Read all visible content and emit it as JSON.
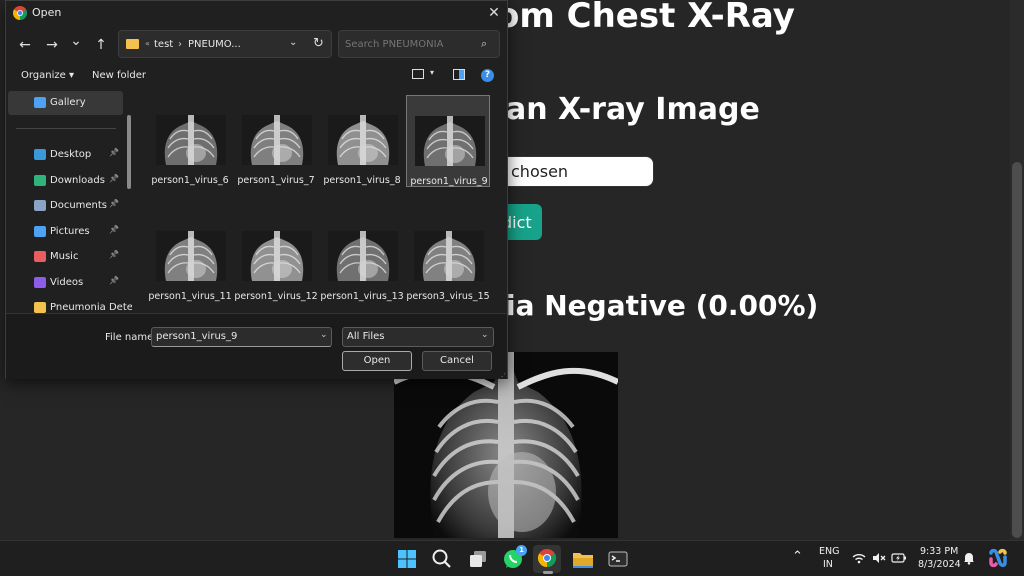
{
  "background_page": {
    "heading": "om Chest X-Ray",
    "upload_heading": "an X-ray Image",
    "file_status": "chosen",
    "predict_button": "dict",
    "result_text": "ia Negative (0.00%)"
  },
  "dialog": {
    "title": "Open",
    "close_glyph": "✕",
    "nav": {
      "back_glyph": "←",
      "forward_glyph": "→",
      "recent_glyph": "⌄",
      "up_glyph": "↑"
    },
    "address": {
      "overflow": "«",
      "crumbs": [
        "test",
        "PNEUMO..."
      ],
      "separator": "›",
      "dropdown_glyph": "⌄",
      "refresh_glyph": "↻"
    },
    "search": {
      "placeholder": "Search PNEUMONIA",
      "icon_glyph": "⌕"
    },
    "commands": {
      "organize": "Organize ▾",
      "new_folder": "New folder",
      "view_dropdown": "▾",
      "help": "?"
    },
    "nav_pane": {
      "items": [
        {
          "label": "Gallery",
          "color": "#4ea1f3",
          "selected": true,
          "pinned": false
        },
        {
          "label": "Desktop",
          "color": "#3a9ad9",
          "selected": false,
          "pinned": true
        },
        {
          "label": "Downloads",
          "color": "#2fb37a",
          "selected": false,
          "pinned": true
        },
        {
          "label": "Documents",
          "color": "#8aa4c8",
          "selected": false,
          "pinned": true
        },
        {
          "label": "Pictures",
          "color": "#4ea1f3",
          "selected": false,
          "pinned": true
        },
        {
          "label": "Music",
          "color": "#e85d5d",
          "selected": false,
          "pinned": true
        },
        {
          "label": "Videos",
          "color": "#8e5de8",
          "selected": false,
          "pinned": true
        },
        {
          "label": "Pneumonia Dete",
          "color": "#f2c14e",
          "selected": false,
          "pinned": false
        }
      ],
      "pin_glyph": "📌"
    },
    "files": [
      {
        "name": "person1_virus_6",
        "selected": false
      },
      {
        "name": "person1_virus_7",
        "selected": false
      },
      {
        "name": "person1_virus_8",
        "selected": false
      },
      {
        "name": "person1_virus_9",
        "selected": true
      },
      {
        "name": "person1_virus_11",
        "selected": false
      },
      {
        "name": "person1_virus_12",
        "selected": false
      },
      {
        "name": "person1_virus_13",
        "selected": false
      },
      {
        "name": "person3_virus_15",
        "selected": false
      },
      {
        "name": "",
        "selected": false
      },
      {
        "name": "",
        "selected": false
      },
      {
        "name": "",
        "selected": false
      },
      {
        "name": "",
        "selected": false
      }
    ],
    "footer": {
      "file_name_label": "File name:",
      "file_name_value": "person1_virus_9",
      "filter": "All Files",
      "dropdown_glyph": "⌄",
      "open_button": "Open",
      "cancel_button": "Cancel",
      "resize_glyph": "⋰"
    }
  },
  "taskbar": {
    "apps": [
      {
        "name": "start",
        "active": false
      },
      {
        "name": "search",
        "active": false
      },
      {
        "name": "task-view",
        "active": false
      },
      {
        "name": "whatsapp",
        "active": false,
        "badge": "1"
      },
      {
        "name": "chrome",
        "active": true
      },
      {
        "name": "file-explorer",
        "active": false
      },
      {
        "name": "terminal",
        "active": false
      }
    ],
    "tray": {
      "chevron": "⌃",
      "language_line1": "ENG",
      "language_line2": "IN",
      "time": "9:33 PM",
      "date": "8/3/2024"
    }
  }
}
